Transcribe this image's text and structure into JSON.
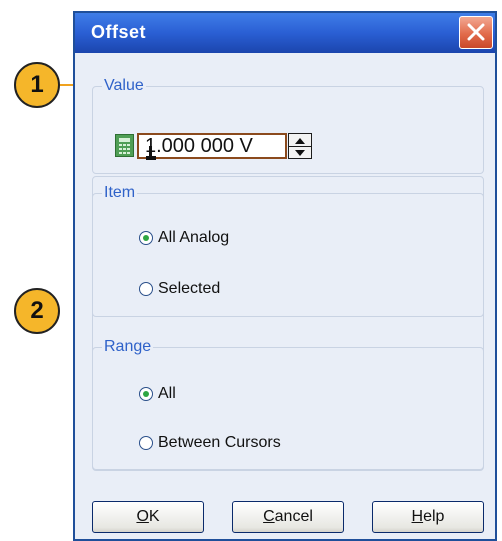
{
  "dialog": {
    "title": "Offset",
    "value_group": {
      "label": "Value",
      "value": "1.000 000 V"
    },
    "item_group": {
      "label": "Item",
      "options": [
        "All Analog",
        "Selected"
      ],
      "selected_index": 0
    },
    "range_group": {
      "label": "Range",
      "options": [
        "All",
        "Between Cursors"
      ],
      "selected_index": 0
    },
    "buttons": {
      "ok_hot": "O",
      "ok_rest": "K",
      "cancel_hot": "C",
      "cancel_rest": "ancel",
      "help_hot": "H",
      "help_rest": "elp"
    }
  },
  "callouts": {
    "one": "1",
    "two": "2"
  },
  "colors": {
    "titlebar": "#2a5fd4",
    "callout_fill": "#f5b62a",
    "group_label": "#2f62c9",
    "radio_checked": "#2ea642"
  },
  "icons": [
    "close-icon",
    "calculator-icon",
    "spin-up-icon",
    "spin-down-icon"
  ]
}
